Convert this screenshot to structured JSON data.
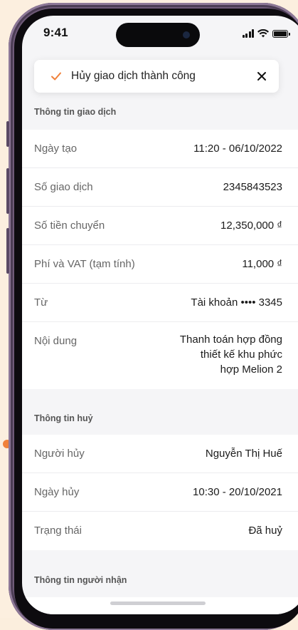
{
  "status_bar": {
    "time": "9:41"
  },
  "toast": {
    "message": "Hủy giao dịch thành công",
    "accent_color": "#f0813a"
  },
  "sections": {
    "transaction": {
      "title": "Thông tin giao dịch",
      "rows": [
        {
          "label": "Ngày tạo",
          "value": "11:20 - 06/10/2022"
        },
        {
          "label": "Số giao dịch",
          "value": "2345843523"
        },
        {
          "label": "Số tiền chuyển",
          "value": "12,350,000 ₫"
        },
        {
          "label": "Phí và VAT (tạm tính)",
          "value": "11,000 ₫"
        },
        {
          "label": "Từ",
          "value": "Tài khoản •••• 3345"
        },
        {
          "label": "Nội dung",
          "value_lines": [
            "Thanh toán hợp đồng",
            "thiết kế khu phức",
            "hợp Melion 2"
          ]
        }
      ]
    },
    "cancellation": {
      "title": "Thông tin huỷ",
      "rows": [
        {
          "label": "Người hủy",
          "value": "Nguyễn Thị Huế"
        },
        {
          "label": "Ngày hủy",
          "value": "10:30 - 20/10/2021"
        },
        {
          "label": "Trạng thái",
          "value": "Đã huỷ"
        }
      ]
    },
    "recipient": {
      "title": "Thông tin người nhận"
    }
  }
}
